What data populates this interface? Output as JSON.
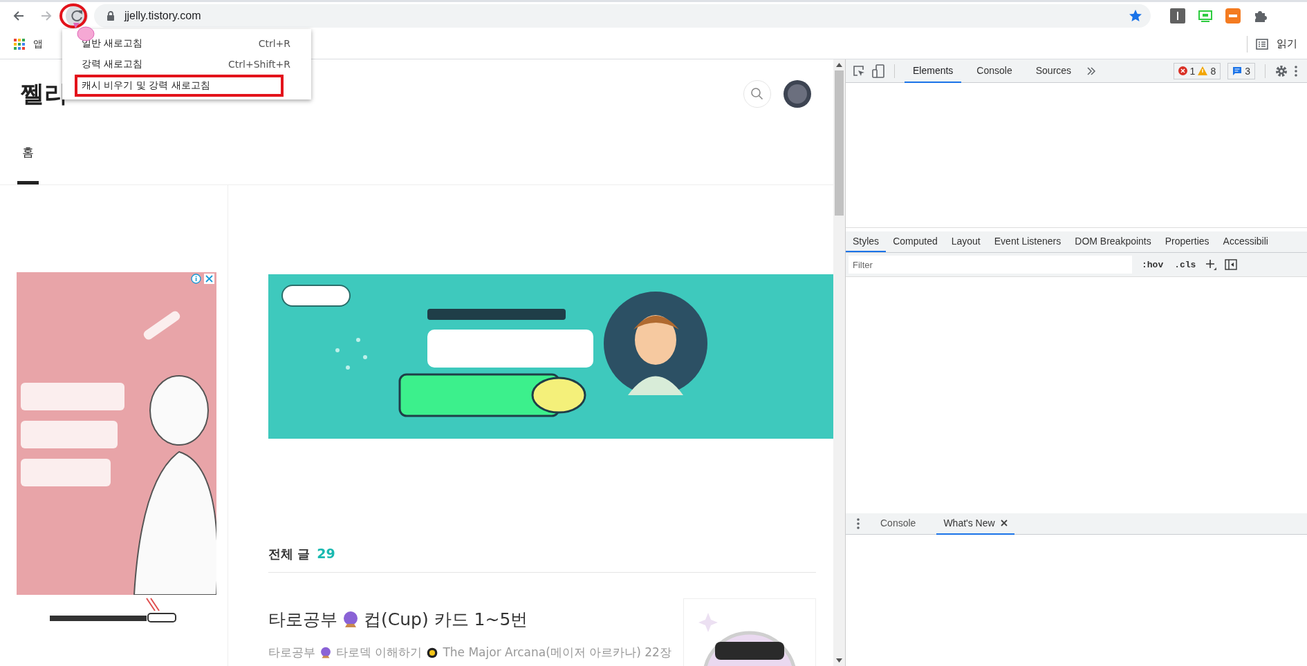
{
  "browser": {
    "address": "jjelly.tistory.com",
    "bookmarks": [
      {
        "label": "앱"
      }
    ],
    "reading_list": "읽기"
  },
  "reload_menu": {
    "items": [
      {
        "label": "일반 새로고침",
        "shortcut": "Ctrl+R",
        "selected": false
      },
      {
        "label": "강력 새로고침",
        "shortcut": "Ctrl+Shift+R",
        "selected": false
      },
      {
        "label": "캐시 비우기 및 강력 새로고침",
        "selected": true
      }
    ]
  },
  "blog": {
    "title": "쩰리",
    "nav": [
      {
        "label": "홈",
        "selected": true
      }
    ],
    "section_title": "전체 글",
    "post_count": "29",
    "posts": [
      {
        "title": [
          {
            "kind": "text",
            "text": "타로공부"
          },
          {
            "kind": "crystal-ball"
          },
          {
            "kind": "text",
            "text": "컵(Cup) 카드 1~5번"
          }
        ],
        "excerpt": [
          {
            "kind": "text",
            "text": "타로공부"
          },
          {
            "kind": "crystal-ball"
          },
          {
            "kind": "text",
            "text": "타로덱 이해하기"
          },
          {
            "kind": "sun"
          },
          {
            "kind": "text",
            "text": "The Major Arcana(메이저 아르카나) 22장"
          }
        ]
      }
    ]
  },
  "devtools": {
    "tabs": [
      {
        "label": "Elements",
        "selected": true
      },
      {
        "label": "Console",
        "selected": false
      },
      {
        "label": "Sources",
        "selected": false
      }
    ],
    "errors": "1",
    "warnings": "8",
    "messages": "3",
    "styles_tabs": [
      {
        "label": "Styles",
        "selected": true
      },
      {
        "label": "Computed",
        "selected": false
      },
      {
        "label": "Layout",
        "selected": false
      },
      {
        "label": "Event Listeners",
        "selected": false
      },
      {
        "label": "DOM Breakpoints",
        "selected": false
      },
      {
        "label": "Properties",
        "selected": false
      },
      {
        "label": "Accessibili",
        "selected": false
      }
    ],
    "filter_placeholder": "Filter",
    "hov": ":hov",
    "cls": ".cls",
    "drawer_tabs": [
      {
        "label": "Console",
        "selected": false,
        "closable": false
      },
      {
        "label": "What's New",
        "selected": true,
        "closable": true
      }
    ]
  }
}
